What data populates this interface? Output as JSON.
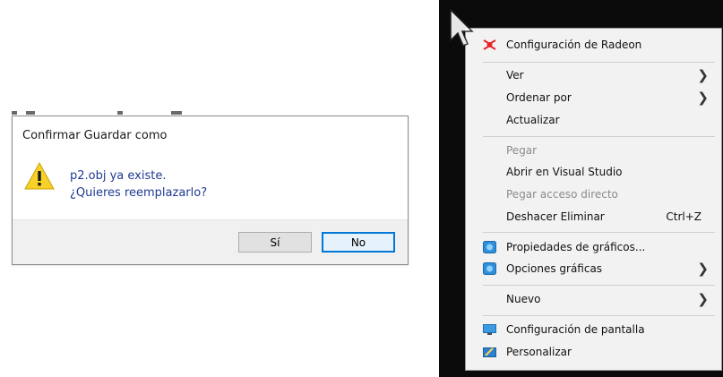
{
  "dialog": {
    "title": "Confirmar Guardar como",
    "message_line1": "p2.obj ya existe.",
    "message_line2": "¿Quieres reemplazarlo?",
    "yes_label": "Sí",
    "no_label": "No",
    "accent_color": "#0078d7"
  },
  "context_menu": {
    "radeon": {
      "label": "Configuración de Radeon",
      "icon": "radeon-icon"
    },
    "view": {
      "label": "Ver"
    },
    "sort_by": {
      "label": "Ordenar por"
    },
    "refresh": {
      "label": "Actualizar"
    },
    "paste": {
      "label": "Pegar",
      "disabled": true
    },
    "open_vs": {
      "label": "Abrir en Visual Studio"
    },
    "paste_shortcut": {
      "label": "Pegar acceso directo",
      "disabled": true
    },
    "undo_delete": {
      "label": "Deshacer Eliminar",
      "shortcut": "Ctrl+Z"
    },
    "graphics_properties": {
      "label": "Propiedades de gráficos...",
      "icon": "intel-graphics-icon"
    },
    "graphics_options": {
      "label": "Opciones gráficas",
      "icon": "intel-graphics-icon"
    },
    "new": {
      "label": "Nuevo"
    },
    "display_settings": {
      "label": "Configuración de pantalla",
      "icon": "display-icon"
    },
    "personalize": {
      "label": "Personalizar",
      "icon": "personalize-icon"
    },
    "submenu_arrow": "❯"
  }
}
